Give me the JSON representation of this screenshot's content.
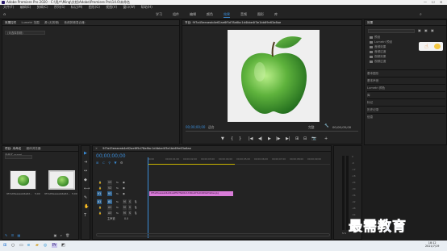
{
  "window": {
    "title": "Adobe Premiere Pro 2020 - C:\\用户\\Ming\\文档\\Adobe\\Premiere Pro\\14.0\\未命名",
    "controls": [
      "—",
      "☐",
      "✕"
    ]
  },
  "menu": [
    "文件(F)",
    "编辑(E)",
    "剪辑(C)",
    "序列(S)",
    "标记(M)",
    "图形(G)",
    "视图(V)",
    "窗口(W)",
    "帮助(H)"
  ],
  "workspaces": [
    {
      "label": "学习",
      "active": false
    },
    {
      "label": "组件",
      "active": false
    },
    {
      "label": "编辑",
      "active": false
    },
    {
      "label": "颜色",
      "active": false
    },
    {
      "label": "效果",
      "active": true
    },
    {
      "label": "音频",
      "active": false
    },
    {
      "label": "图形",
      "active": false
    },
    {
      "label": "库",
      "active": false
    }
  ],
  "source_panel": {
    "tabs": [
      "效果控件",
      "Lumetri 范围",
      "源:(无剪辑)",
      "音频剪辑混合器:"
    ],
    "dropdown": "(未选择剪辑)"
  },
  "program_monitor": {
    "title": "节目: 9f7a45eeaeab4e62ae6f5d78a6bc1d4bbe4f3e1bb69e63a6ae",
    "timecode": "00;00;00;00",
    "fit": "适合",
    "full": "完整",
    "duration": "00;00;05;00",
    "transport": [
      "▼",
      "{",
      "}",
      "|◀",
      "◀|",
      "▶",
      "|▶",
      "▶|",
      "⊞",
      "⊟",
      "📷",
      "+"
    ]
  },
  "effects_panel": {
    "title": "效果",
    "items": [
      "预设",
      "Lumetri 预设",
      "音频效果",
      "音频过渡",
      "视频效果",
      "视频过渡"
    ],
    "sections": [
      "基本图形",
      "基本声音",
      "Lumetri 颜色",
      "库",
      "标记",
      "历史记录",
      "信息"
    ]
  },
  "project_panel": {
    "tabs": [
      "项目: 未命名",
      "媒体浏览器"
    ],
    "filename": "未命名.prproj",
    "items": [
      {
        "label": "9f7a45eeaeab4e62...",
        "duration": "5;00",
        "selected": false
      },
      {
        "label": "9f7a45eeaeab4e62...",
        "duration": "5;00",
        "selected": true
      }
    ]
  },
  "tools": [
    "▶",
    "⇥",
    "↔",
    "◆",
    "⟷",
    "✎",
    "✋",
    "T"
  ],
  "timeline": {
    "tab": "9f7a45eeaeab4e62ae6f5d78a6bc1d4bbe4f3e1bb69e63a6ae",
    "timecode": "00;00;00;00",
    "ruler": [
      "00;00",
      "00;00;01;00",
      "00;00;02;00",
      "00;00;03;00",
      "00;00;04;00",
      "00;00;05;00",
      "00;00;06;00",
      "00;00;07;00",
      "00;00;08;00",
      "00;00;09;00"
    ],
    "video_tracks": [
      "V3",
      "V2",
      "V1"
    ],
    "audio_tracks": [
      "A1",
      "A2",
      "A3"
    ],
    "master": "主声道",
    "master_value": "0.0",
    "clip_label": "9f7a45eeaeab4e62ae6f5d78a6bc1d4bbe4f3e1bb69e63a6ae.jpg"
  },
  "audio_meter": {
    "labels": [
      "0",
      "-6",
      "-12",
      "-18",
      "-24",
      "-30",
      "-36",
      "-42",
      "-48",
      "-54",
      "dB"
    ],
    "footer": "S S"
  },
  "taskbar": {
    "time": "18:12",
    "date": "2021/7/19"
  },
  "watermark": "最需教育"
}
